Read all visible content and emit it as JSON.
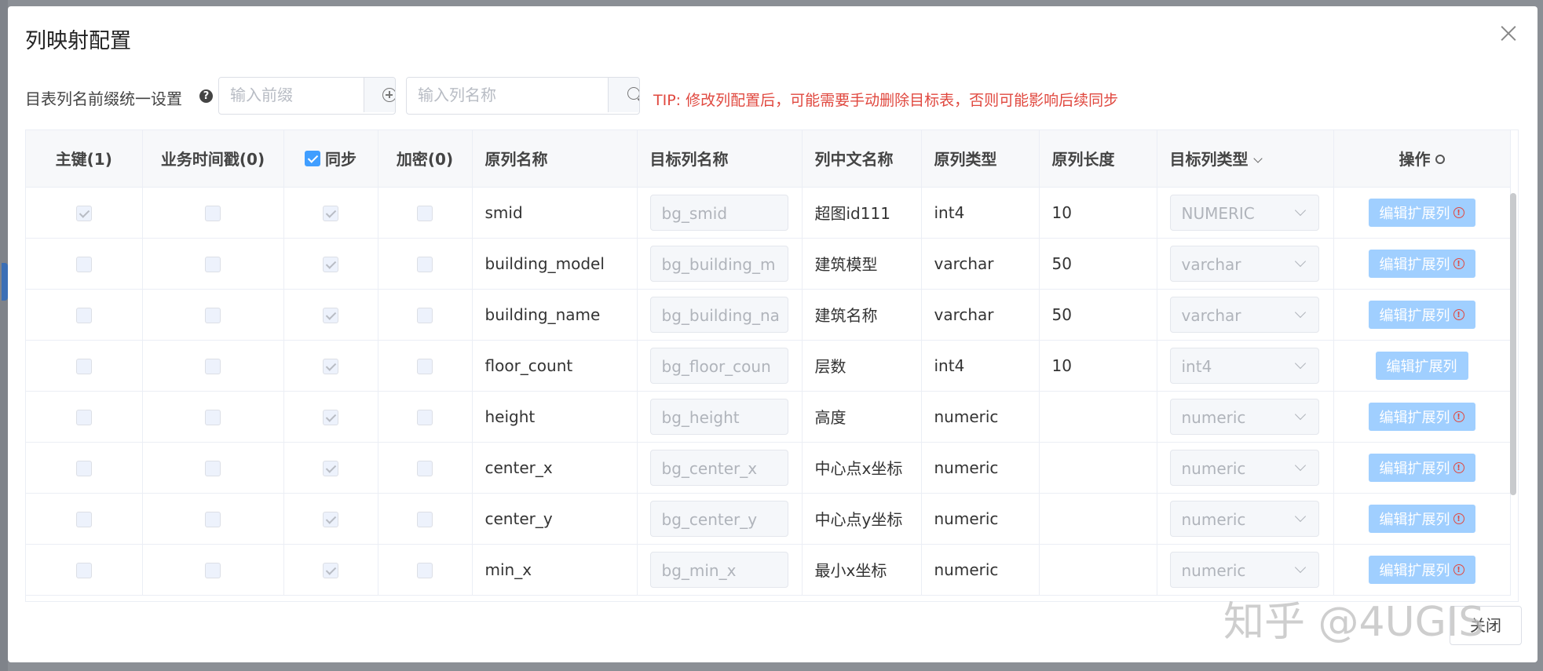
{
  "dialog": {
    "title": "列映射配置",
    "close_button_label": "关闭"
  },
  "toolbar": {
    "prefix_label": "目表列名前缀统一设置",
    "prefix_placeholder": "输入前缀",
    "column_search_placeholder": "输入列名称",
    "tip": "TIP: 修改列配置后，可能需要手动删除目标表，否则可能影响后续同步"
  },
  "table": {
    "headers": {
      "primary_key": "主键(1)",
      "business_time": "业务时间戳(0)",
      "sync": "同步",
      "encrypt": "加密(0)",
      "source_name": "原列名称",
      "target_name": "目标列名称",
      "chinese_name": "列中文名称",
      "source_type": "原列类型",
      "source_length": "原列长度",
      "target_type": "目标列类型",
      "actions": "操作"
    },
    "edit_label": "编辑扩展列",
    "rows": [
      {
        "pk": true,
        "sync": true,
        "source_name": "smid",
        "target_name": "bg_smid",
        "chinese_name": "超图id111",
        "source_type": "int4",
        "source_length": "10",
        "target_type": "NUMERIC",
        "warn": true
      },
      {
        "pk": false,
        "sync": true,
        "source_name": "building_model",
        "target_name": "bg_building_m",
        "chinese_name": "建筑模型",
        "source_type": "varchar",
        "source_length": "50",
        "target_type": "varchar",
        "warn": true
      },
      {
        "pk": false,
        "sync": true,
        "source_name": "building_name",
        "target_name": "bg_building_na",
        "chinese_name": "建筑名称",
        "source_type": "varchar",
        "source_length": "50",
        "target_type": "varchar",
        "warn": true
      },
      {
        "pk": false,
        "sync": true,
        "source_name": "floor_count",
        "target_name": "bg_floor_coun",
        "chinese_name": "层数",
        "source_type": "int4",
        "source_length": "10",
        "target_type": "int4",
        "warn": false
      },
      {
        "pk": false,
        "sync": true,
        "source_name": "height",
        "target_name": "bg_height",
        "chinese_name": "高度",
        "source_type": "numeric",
        "source_length": "",
        "target_type": "numeric",
        "warn": true
      },
      {
        "pk": false,
        "sync": true,
        "source_name": "center_x",
        "target_name": "bg_center_x",
        "chinese_name": "中心点x坐标",
        "source_type": "numeric",
        "source_length": "",
        "target_type": "numeric",
        "warn": true
      },
      {
        "pk": false,
        "sync": true,
        "source_name": "center_y",
        "target_name": "bg_center_y",
        "chinese_name": "中心点y坐标",
        "source_type": "numeric",
        "source_length": "",
        "target_type": "numeric",
        "warn": true
      },
      {
        "pk": false,
        "sync": true,
        "source_name": "min_x",
        "target_name": "bg_min_x",
        "chinese_name": "最小x坐标",
        "source_type": "numeric",
        "source_length": "",
        "target_type": "numeric",
        "warn": true
      }
    ]
  },
  "watermark": "知乎 @4UGIS"
}
